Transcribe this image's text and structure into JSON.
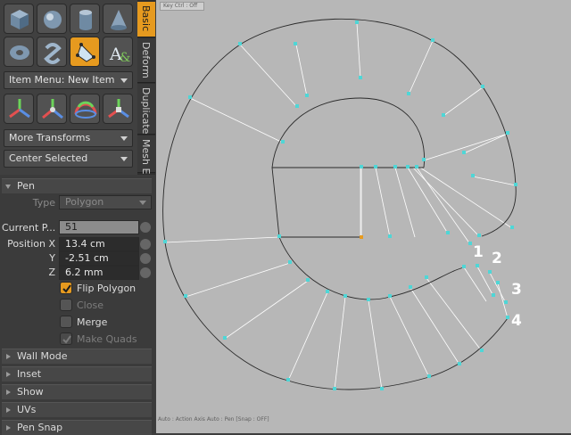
{
  "viewport": {
    "top_label": "Key Ctrl : Off",
    "status_bar": "Auto : Action Axis Auto : Pen [Snap : OFF]",
    "annotations": [
      "1",
      "2",
      "3",
      "4"
    ]
  },
  "toolbar_icons": [
    "cube-icon",
    "sphere-icon",
    "cylinder-icon",
    "cone-icon",
    "torus-icon",
    "capsule-icon",
    "pen-tool-icon",
    "text-tool-icon"
  ],
  "transform_icons": [
    "move-icon",
    "rotate-icon",
    "scale-icon",
    "transform-icon"
  ],
  "dropdowns": {
    "item_menu": "Item Menu: New Item",
    "more_transforms": "More Transforms",
    "center_selected": "Center Selected"
  },
  "vertical_tabs": [
    "Basic",
    "Deform",
    "Duplicate",
    "Mesh E"
  ],
  "pen": {
    "title": "Pen",
    "type_label": "Type",
    "type_value": "Polygon",
    "current_label": "Current P...",
    "current_value": "51",
    "position_x_label": "Position X",
    "position_x": "13.4 cm",
    "position_y_label": "Y",
    "position_y": "-2.51 cm",
    "position_z_label": "Z",
    "position_z": "6.2 mm",
    "flip_polygon": "Flip Polygon",
    "close": "Close",
    "merge": "Merge",
    "make_quads": "Make Quads"
  },
  "sections": [
    "Wall Mode",
    "Inset",
    "Show",
    "UVs",
    "Pen Snap"
  ],
  "colors": {
    "accent": "#e69a1f",
    "viewport_bg": "#b7b7b7",
    "vertex": "#56e0e0"
  }
}
